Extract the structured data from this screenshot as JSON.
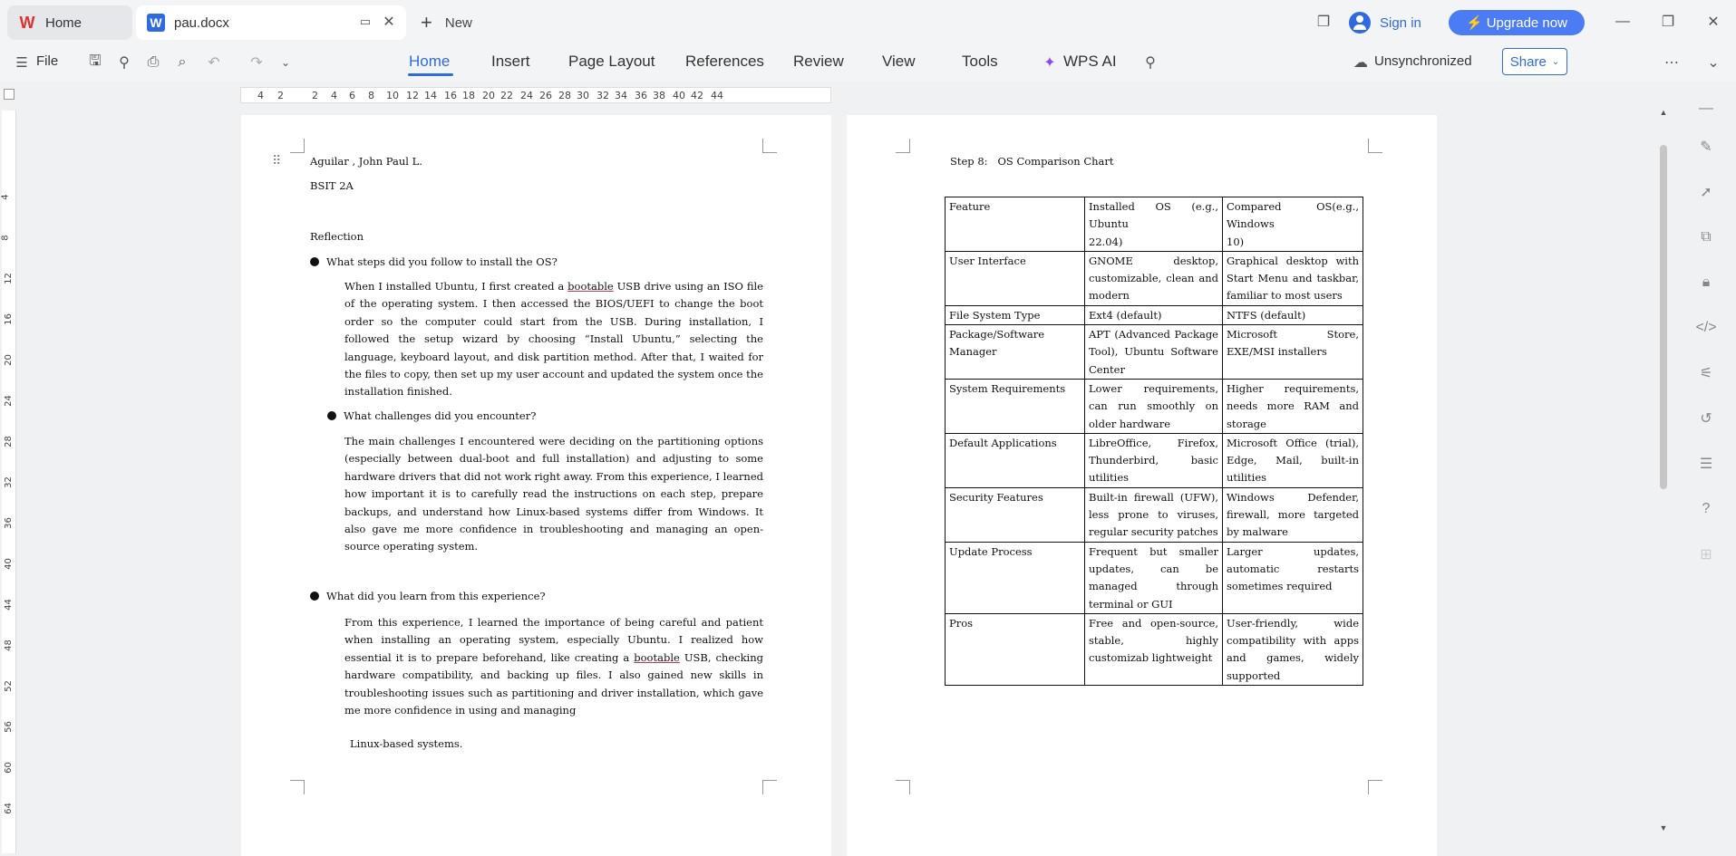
{
  "tabs": {
    "home": "Home",
    "doc": "pau.docx",
    "new": "New"
  },
  "account": {
    "signin": "Sign in",
    "upgrade": "Upgrade now"
  },
  "menu": {
    "file": "File",
    "items": [
      "Home",
      "Insert",
      "Page Layout",
      "References",
      "Review",
      "View",
      "Tools"
    ],
    "wps_ai": "WPS AI"
  },
  "status": {
    "sync": "Unsynchronized",
    "share": "Share"
  },
  "ruler": {
    "h": [
      "4",
      "2",
      "2",
      "4",
      "6",
      "8",
      "10",
      "12",
      "14",
      "16",
      "18",
      "20",
      "22",
      "24",
      "26",
      "28",
      "30",
      "32",
      "34",
      "36",
      "38",
      "40",
      "42",
      "44"
    ],
    "v": [
      "4",
      "8",
      "12",
      "16",
      "20",
      "24",
      "28",
      "32",
      "36",
      "40",
      "44",
      "48",
      "52",
      "56",
      "60",
      "64"
    ]
  },
  "page1": {
    "name": "Aguilar , John Paul L.",
    "section": "BSIT 2A",
    "heading": "Reflection",
    "q1": "What steps did you follow to install the OS?",
    "a1_pre": "When I installed Ubuntu, I first created a ",
    "a1_sq": "bootable",
    "a1_post": " USB drive using an ISO file of the operating system. I then accessed the BIOS/UEFI to change the boot order so the computer could start from the USB. During installation, I followed the setup wizard by choosing “Install Ubuntu,” selecting the language, keyboard layout, and disk partition method. After that, I waited for the files to copy, then set up my user account and updated the system once the installation finished.",
    "q2": "What challenges did you encounter?",
    "a2": "The main challenges I encountered were deciding on the partitioning options (especially between dual-boot and full installation) and adjusting to some hardware drivers that did not work right away. From this experience, I learned how important it is to carefully read the instructions on each step, prepare backups, and understand how Linux-based systems differ from Windows. It also gave me more confidence in troubleshooting and managing an open-source operating system.",
    "q3": "What did you learn from this experience?",
    "a3_pre": "From this experience, I learned the importance of being careful and patient when installing an operating system, especially Ubuntu. I realized how essential it is to prepare beforehand, like creating a ",
    "a3_sq": "bootable",
    "a3_post": " USB, checking hardware compatibility, and backing up files. I also gained new skills in troubleshooting issues such as partitioning and driver installation, which gave me more confidence in using and managing",
    "a3_last": "Linux-based systems."
  },
  "page2": {
    "title": "Step 8:   OS Comparison Chart",
    "rows": [
      [
        "Feature",
        "Installed OS (e.g., Ubuntu\n22.04)",
        "Compared OS(e.g., Windows\n10)"
      ],
      [
        "User Interface",
        "GNOME desktop, customizable, clean and modern",
        "Graphical desktop with Start Menu and taskbar, familiar to most users"
      ],
      [
        "File System Type",
        "Ext4 (default)",
        "NTFS (default)"
      ],
      [
        "Package/Software Manager",
        "APT (Advanced Package Tool), Ubuntu Software Center",
        "Microsoft Store, EXE/MSI installers"
      ],
      [
        "System Requirements",
        "Lower requirements, can run smoothly on older hardware",
        "Higher requirements, needs more RAM and storage"
      ],
      [
        "Default Applications",
        "LibreOffice, Firefox, Thunderbird, basic utilities",
        "Microsoft Office (trial), Edge, Mail, built-in utilities"
      ],
      [
        "Security Features",
        "Built-in firewall (UFW), less prone to viruses, regular security patches",
        "Windows Defender, firewall, more targeted by malware"
      ],
      [
        "Update Process",
        "Frequent but smaller updates, can be managed through terminal or GUI",
        "Larger updates, automatic restarts sometimes required"
      ],
      [
        "Pros",
        "Free and open-source, stable, highly customizab lightweight",
        "User-friendly, wide compatibility with apps and games, widely supported"
      ]
    ]
  }
}
